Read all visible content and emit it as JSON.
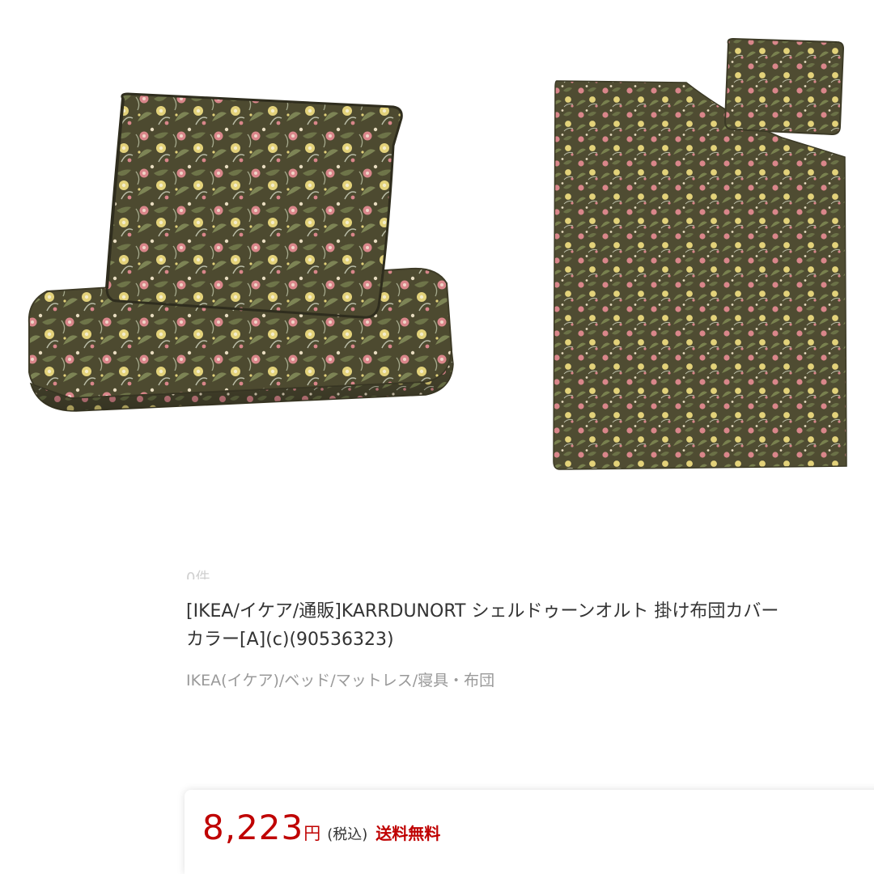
{
  "product": {
    "images": [
      {
        "name": "duvet-cover-set-folded-photo"
      },
      {
        "name": "duvet-cover-set-flat-photo"
      }
    ],
    "result_count": "0件",
    "title_line1": "[IKEA/イケア/通販]KARRDUNORT シェルドゥーンオルト 掛け布団カバー",
    "title_line2": "カラー[A](c)(90536323)",
    "category": "IKEA(イケア)/ベッド/マットレス/寝具・布団"
  },
  "price": {
    "value": "8,223",
    "currency": "円",
    "tax_label": "(税込)",
    "shipping_label": "送料無料"
  },
  "colors": {
    "fabric_base": "#4d4a30",
    "flower_pink": "#d9868a",
    "flower_yellow": "#e3d27a",
    "leaf_light": "#b9bca6",
    "price_red": "#bf0000"
  }
}
